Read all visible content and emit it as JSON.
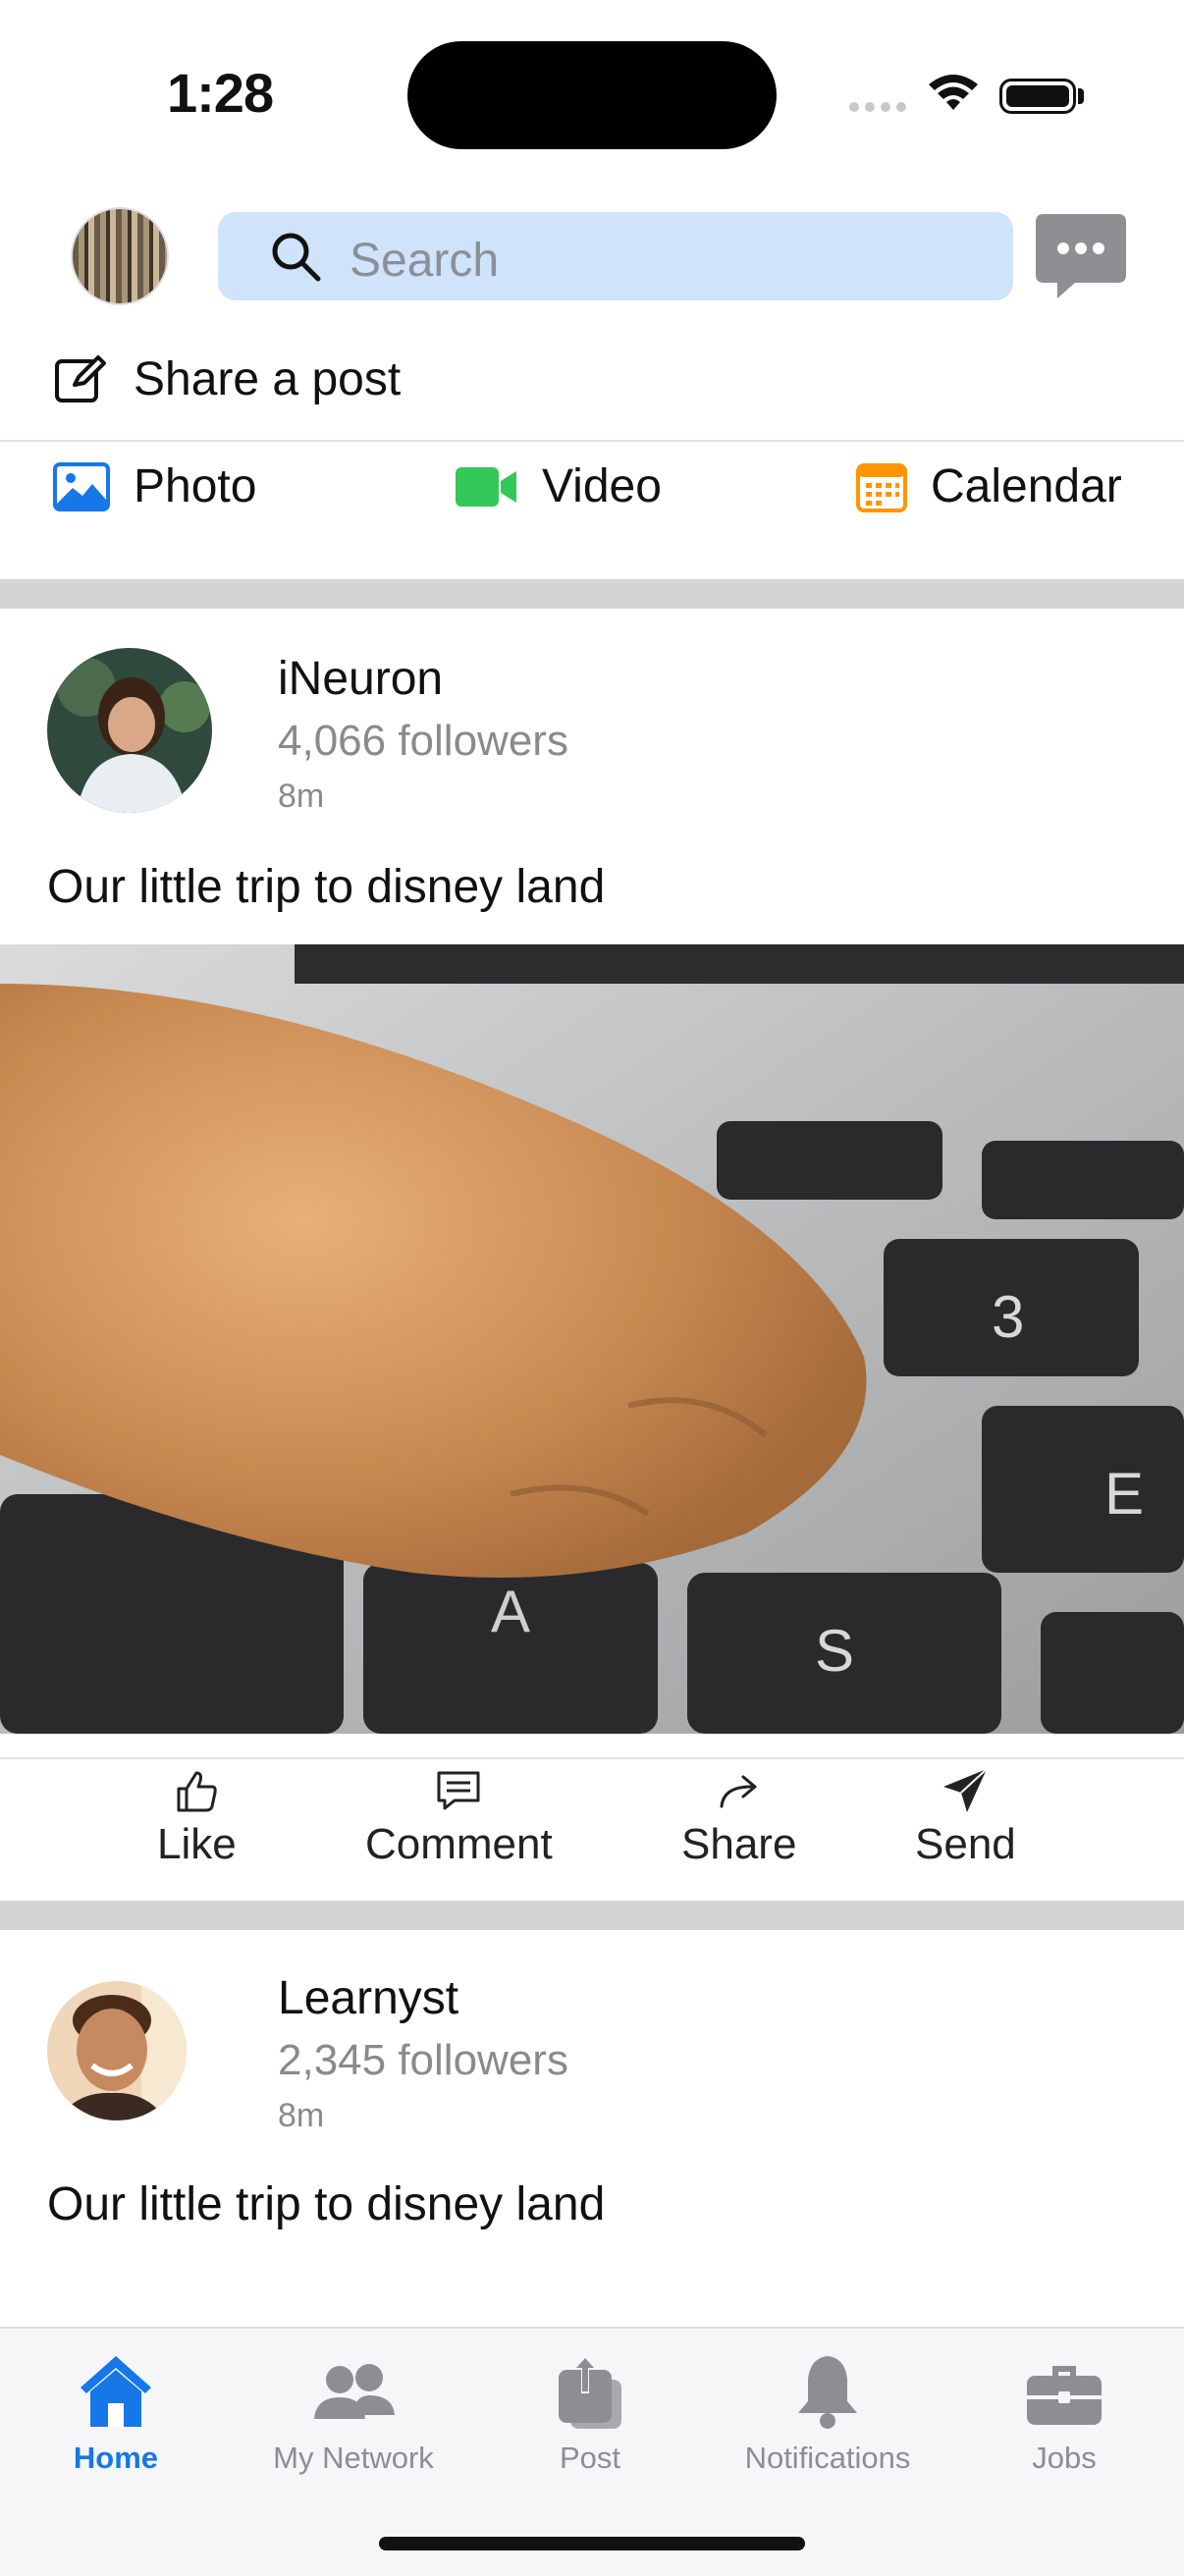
{
  "status_bar": {
    "time": "1:28"
  },
  "header": {
    "search_placeholder": "Search"
  },
  "composer": {
    "share_label": "Share a post",
    "photo_label": "Photo",
    "video_label": "Video",
    "calendar_label": "Calendar"
  },
  "posts": [
    {
      "author": "iNeuron",
      "followers": "4,066 followers",
      "time": "8m",
      "text": "Our little trip to disney land"
    },
    {
      "author": "Learnyst",
      "followers": "2,345 followers",
      "time": "8m",
      "text": "Our little trip to disney land"
    }
  ],
  "actions": {
    "like": "Like",
    "comment": "Comment",
    "share": "Share",
    "send": "Send"
  },
  "tabs": [
    {
      "label": "Home",
      "icon": "house-icon"
    },
    {
      "label": "My Network",
      "icon": "people-icon"
    },
    {
      "label": "Post",
      "icon": "upload-icon"
    },
    {
      "label": "Notifications",
      "icon": "bell-icon"
    },
    {
      "label": "Jobs",
      "icon": "briefcase-icon"
    }
  ],
  "colors": {
    "accent": "#1677e8",
    "search_bg": "#cfe3fb",
    "video": "#34c759",
    "calendar": "#ff9500",
    "separator": "#d4d4d4"
  }
}
